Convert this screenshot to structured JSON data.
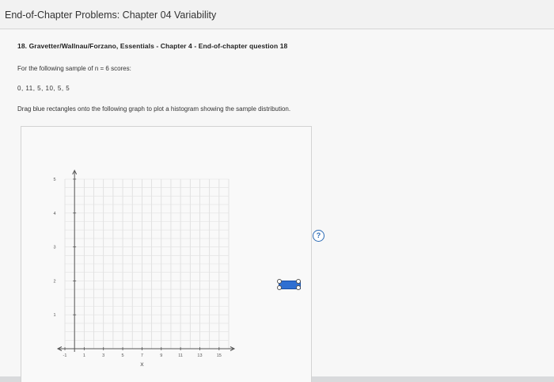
{
  "window": {
    "title": "End-of-Chapter Problems: Chapter 04 Variability"
  },
  "question": {
    "header": "18. Gravetter/Wallnau/Forzano, Essentials",
    "header_sep1": " - ",
    "chapter": "Chapter 4",
    "header_sep2": " - ",
    "source": "End-of-chapter question 18",
    "prompt": "For the following sample of n = 6 scores:",
    "scores": "0, 11, 5, 10, 5, 5",
    "instruction": "Drag blue rectangles onto the following graph to plot a histogram showing the sample distribution."
  },
  "help": {
    "symbol": "?"
  },
  "draggable": {
    "color": "#2f6fd1",
    "icon": "blue-rectangle"
  },
  "chart_data": {
    "type": "bar",
    "title": "",
    "xlabel": "X",
    "ylabel": "",
    "x_ticks": [
      -1,
      1,
      3,
      5,
      7,
      9,
      11,
      13,
      15
    ],
    "y_ticks": [
      1,
      2,
      3,
      4,
      5
    ],
    "xlim": [
      -1,
      16
    ],
    "ylim": [
      0,
      5
    ],
    "grid": true,
    "categories": [],
    "values": []
  }
}
